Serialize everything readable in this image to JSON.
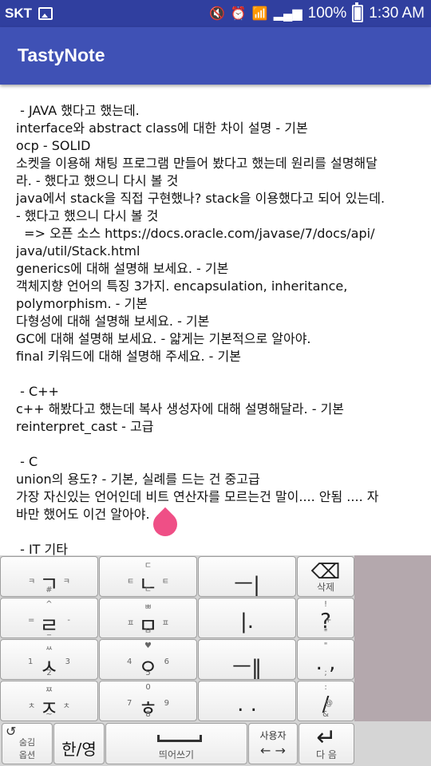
{
  "status_bar": {
    "carrier": "SKT",
    "battery": "100%",
    "time": "1:30 AM",
    "icons": [
      "image-icon",
      "mute-icon",
      "alarm-icon",
      "wifi-icon",
      "signal-icon",
      "battery-icon"
    ]
  },
  "app": {
    "title": "TastyNote"
  },
  "note": {
    "lines": [
      " - JAVA 했다고 했는데.",
      "interface와 abstract class에 대한 차이 설명 - 기본",
      "ocp - SOLID",
      "소켓을 이용해 채팅 프로그램 만들어 봤다고 했는데 원리를 설명해달",
      "라. - 했다고 했으니 다시 볼 것",
      "java에서 stack을 직접 구현했나? stack을 이용했다고 되어 있는데.",
      "- 했다고 했으니 다시 볼 것",
      "  => 오픈 소스 https://docs.oracle.com/javase/7/docs/api/",
      "java/util/Stack.html",
      "generics에 대해 설명해 보세요. - 기본",
      "객체지향 언어의 특징 3가지. encapsulation, inheritance,",
      "polymorphism. - 기본",
      "다형성에 대해 설명해 보세요. - 기본",
      "GC에 대해 설명해 보세요. - 얇게는 기본적으로 알아야.",
      "final 키워드에 대해 설명해 주세요. - 기본",
      "",
      " - C++",
      "c++ 해봤다고 했는데 복사 생성자에 대해 설명해달라. - 기본",
      "reinterpret_cast - 고급",
      "",
      " - C",
      "union의 용도? - 기본, 실례를 드는 건 중고급",
      "가장 자신있는 언어인데 비트 연산자를 모르는건 말이.... 안됨 .... 자",
      "바만 했어도 이건 알아야.",
      "",
      " - IT 기타"
    ]
  },
  "keyboard": {
    "k1": {
      "main": "ㄱ",
      "tl": "ㅋ",
      "tr": "ㅋ",
      "bot": "#"
    },
    "k2": {
      "main": "ㄴ",
      "top": "ㄷ",
      "tl": "ㅌ",
      "tr": "ㅌ",
      "bot": "ㄷ"
    },
    "k3": {
      "main": "ㅡ|"
    },
    "k4": {
      "main": "⌫",
      "label": "삭제"
    },
    "k5": {
      "main": "ㄹ",
      "top": "^",
      "tl": "=",
      "tr": "-",
      "bot": "_"
    },
    "k6": {
      "main": "ㅁ",
      "top": "ㅃ",
      "tl": "ㅍ",
      "tr": "ㅍ",
      "bot": "ㅂ"
    },
    "k7": {
      "main": "|."
    },
    "k8": {
      "main": "?",
      "top": "!",
      "tl": "+",
      "bot": "*"
    },
    "k9": {
      "main": "ㅅ",
      "top": "ㅆ",
      "tl": "1",
      "tr": "3",
      "bot": "2"
    },
    "k10": {
      "main": "ㅇ",
      "top": "♥",
      "tl": "4",
      "tr": "6",
      "bot": "5"
    },
    "k11": {
      "main": "ㅡ‖"
    },
    "k12": {
      "main": ". ,",
      "top": "\"",
      "bot": ";"
    },
    "k13": {
      "main": "ㅈ",
      "top": "ㅉ",
      "tl": "ㅊ",
      "tr": "ㅊ",
      "bot": "~"
    },
    "k14": {
      "main": "ㅎ",
      "top": "0",
      "tl": "7",
      "tr": "9",
      "bot": "8"
    },
    "k15": {
      "main": ". ."
    },
    "k16": {
      "main": "/",
      "top": ":",
      "tl": "@",
      "bot": "&"
    },
    "options": {
      "label": "숨김\n옵션"
    },
    "lang": {
      "label": "한/영"
    },
    "space": {
      "label": "띄어쓰기"
    },
    "user": {
      "label": "사용자",
      "arrows": "← →"
    },
    "enter": {
      "label": "다 음"
    }
  },
  "colors": {
    "appbar": "#3f51b5",
    "statusbar": "#303f9f",
    "cursor_handle": "#ef4f86"
  }
}
